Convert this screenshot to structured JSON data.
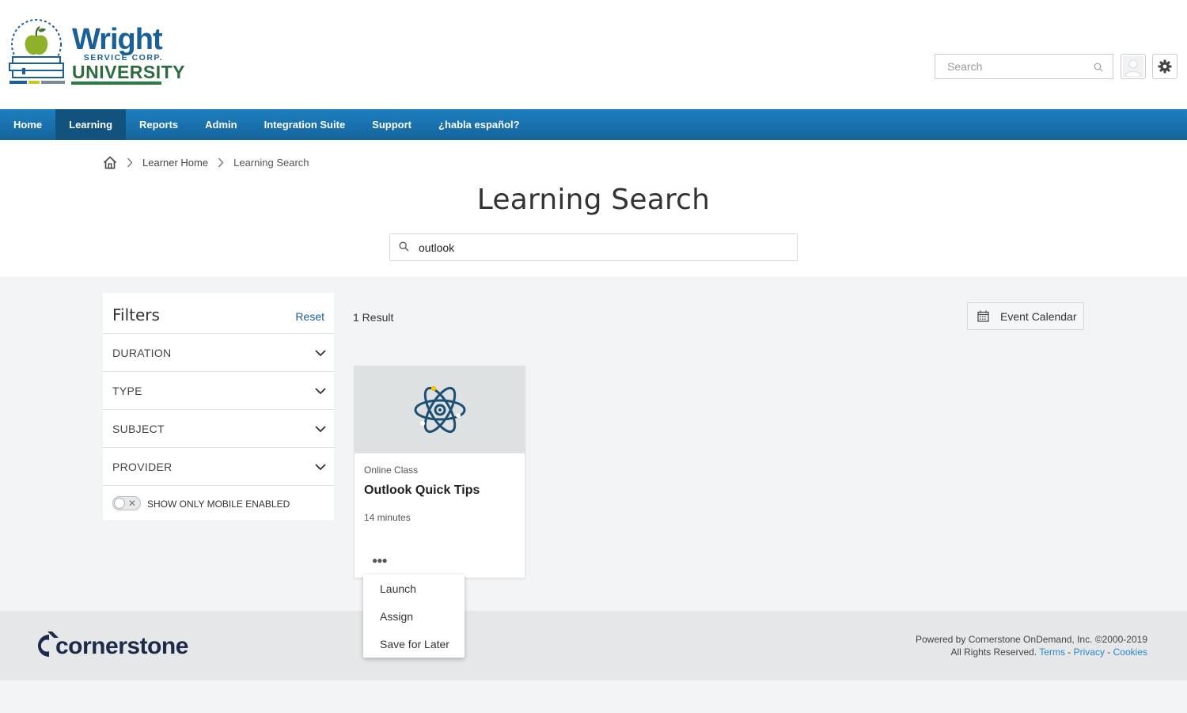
{
  "brand": {
    "logo_main": "Wright",
    "logo_sub": "SERVICE CORP.",
    "logo_uni": "UNIVERSITY"
  },
  "header": {
    "search_placeholder": "Search"
  },
  "nav": {
    "items": [
      {
        "label": "Home"
      },
      {
        "label": "Learning",
        "active": true
      },
      {
        "label": "Reports"
      },
      {
        "label": "Admin"
      },
      {
        "label": "Integration Suite"
      },
      {
        "label": "Support"
      },
      {
        "label": "¿habla español?"
      }
    ]
  },
  "breadcrumb": {
    "learner_home": "Learner Home",
    "current": "Learning Search"
  },
  "page": {
    "title": "Learning Search",
    "search_value": "outlook"
  },
  "filters": {
    "title": "Filters",
    "reset": "Reset",
    "rows": [
      "DURATION",
      "TYPE",
      "SUBJECT",
      "PROVIDER"
    ],
    "toggle_label": "SHOW ONLY MOBILE ENABLED",
    "toggle_on": false
  },
  "results": {
    "count_label": "1 Result",
    "event_calendar": "Event Calendar",
    "card": {
      "type": "Online Class",
      "title": "Outlook Quick Tips",
      "duration": "14 minutes",
      "more": "●●●",
      "icon": "atom-icon"
    },
    "menu": [
      "Launch",
      "Assign",
      "Save for Later"
    ]
  },
  "footer": {
    "logo": "cornerstone",
    "powered": "Powered by Cornerstone OnDemand, Inc. ©2000-2019",
    "rights": "All Rights Reserved.",
    "terms": "Terms",
    "privacy": "Privacy",
    "cookies": "Cookies",
    "sep": " - "
  },
  "colors": {
    "nav": "#1d7fbf",
    "nav_active": "#11527f",
    "brand_blue": "#1a5f96",
    "link": "#2b87c9"
  }
}
